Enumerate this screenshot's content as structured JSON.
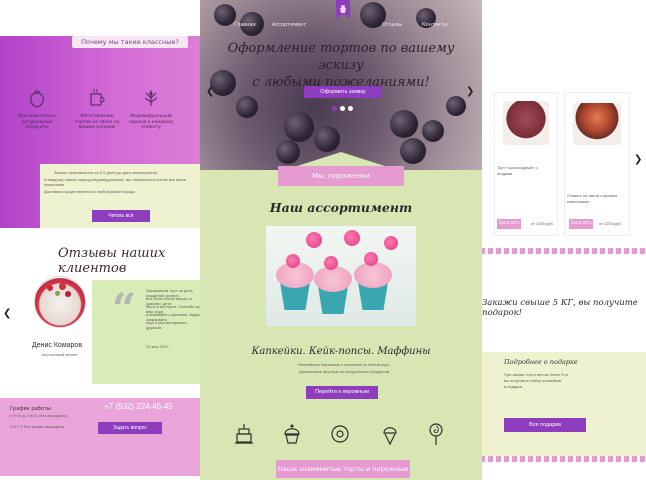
{
  "left": {
    "header_tab": "Почему мы такие классные?",
    "features": [
      {
        "icon": "strawberry-icon",
        "text": "Исключительно натуральные продукты"
      },
      {
        "icon": "mug-icon",
        "text": "Изготовление тортов на заказ по вашим эскизам"
      },
      {
        "icon": "leaf-icon",
        "text": "Индивидуальный подход к каждому клиенту"
      }
    ],
    "info_lines": [
      "Заказы принимаются за 3-5 дней до даты мероприятия",
      "К каждому заказу подход индивидуальный, мы обязательно учтём все ваши пожелания",
      "Доставка осуществляется в любой район города"
    ],
    "more_button": "Читать всё",
    "reviews_title": "Отзывы наших клиентов",
    "reviewer_name": "Денис Комаров",
    "reviewer_sub": "постоянный клиент",
    "review_text": [
      "Заказывали торт на день рождения дочери,",
      "все было очень вкусно и красиво, дети",
      "были в восторге. Спасибо за ваш труд",
      "и внимание к деталям. Будем заказывать",
      "ещё и рекомендовать друзьям."
    ],
    "review_date": "21 мая 2017",
    "footer_schedule_label": "График работы:",
    "footer_schedule": "с 9:00 до 19:00 (без выходных)",
    "footer_phone": "+7 (932) 224-45-45",
    "footer_button": "Задать вопрос",
    "footer_copyright": "2017 © Все права защищены"
  },
  "center": {
    "nav": [
      "Главная",
      "Ассортимент",
      "Отзывы",
      "Контакты"
    ],
    "hero_title_line1": "Оформление тортов по вашему эскизу",
    "hero_title_line2": "с любыми пожеланиями!",
    "hero_button": "Оформить заявку",
    "banner": "Мы, пироженки",
    "assortment_title": "Наш ассортимент",
    "product_title": "Капкейки. Кейк-попсы. Маффины",
    "product_desc_line1": "Нежнейшие пирожные с начинкой на любой вкус,",
    "product_desc_line2": "украшенные вручную из натуральных продуктов",
    "product_button": "Перейти к пирожным",
    "icons": [
      "cake-icon",
      "cupcake-icon",
      "donut-icon",
      "icecream-icon",
      "lollipop-icon"
    ],
    "bottom_band": "Наши знаменитые торты и пирожные"
  },
  "right": {
    "cards": [
      {
        "name_line1": "Торт «шоколадный» с",
        "name_line2": "ягодами",
        "price": "от 2200 руб.",
        "button": "Заказать"
      },
      {
        "name_line1": "Ставьте на свечи с кремом",
        "name_line2": "малиновым",
        "price": "от 2200 руб.",
        "button": "Заказать"
      }
    ],
    "promo_text": "Закажи свыше 5 КГ, вы получите подарок!",
    "promo_link": "Подробнее о подарке",
    "promo_desc": [
      "При заказе торта весом более 5 кг",
      "вы получаете набор капкейков",
      "в подарок"
    ],
    "promo_button": "Все подарки"
  },
  "colors": {
    "purple_button": "#8d3dbd",
    "pink_band": "#e59ad0",
    "green_bg": "#d8e6b3",
    "magenta_gradient": "#b042c9"
  }
}
